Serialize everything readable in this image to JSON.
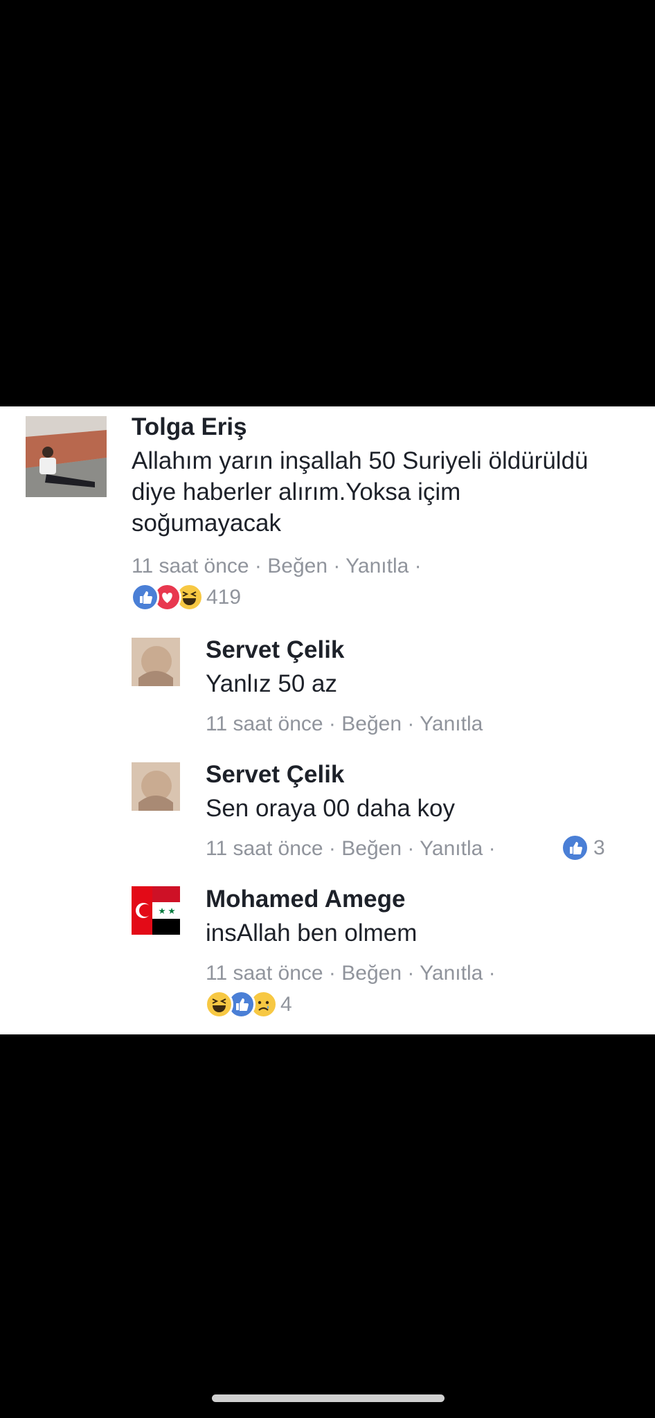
{
  "comments": [
    {
      "author": "Tolga Eriş",
      "text": "Allahım yarın inşallah 50 Suriyeli öldürüldü diye haberler alırım.Yoksa içim soğumayacak",
      "time": "11 saat önce",
      "like": "Beğen",
      "reply": "Yanıtla",
      "reactions": [
        "like-icon",
        "love-icon",
        "haha-icon"
      ],
      "reaction_count": "419"
    },
    {
      "author": "Servet Çelik",
      "text": "Yanlız 50 az",
      "time": "11 saat önce",
      "like": "Beğen",
      "reply": "Yanıtla"
    },
    {
      "author": "Servet Çelik",
      "text": "Sen oraya 00 daha koy",
      "time": "11 saat önce",
      "like": "Beğen",
      "reply": "Yanıtla",
      "reactions": [
        "like-icon"
      ],
      "reaction_count": "3"
    },
    {
      "author": "Mohamed Amege",
      "text": "insAllah ben olmem",
      "time": "11 saat önce",
      "like": "Beğen",
      "reply": "Yanıtla",
      "reactions": [
        "haha-icon",
        "like-icon",
        "sad-icon"
      ],
      "reaction_count": "4"
    }
  ],
  "separator": " · ",
  "colors": {
    "like_blue": "#4a7fd6",
    "love_red": "#e8384f",
    "haha_yellow": "#f7c843",
    "meta_gray": "#90949c",
    "name_dark": "#1d2129"
  }
}
